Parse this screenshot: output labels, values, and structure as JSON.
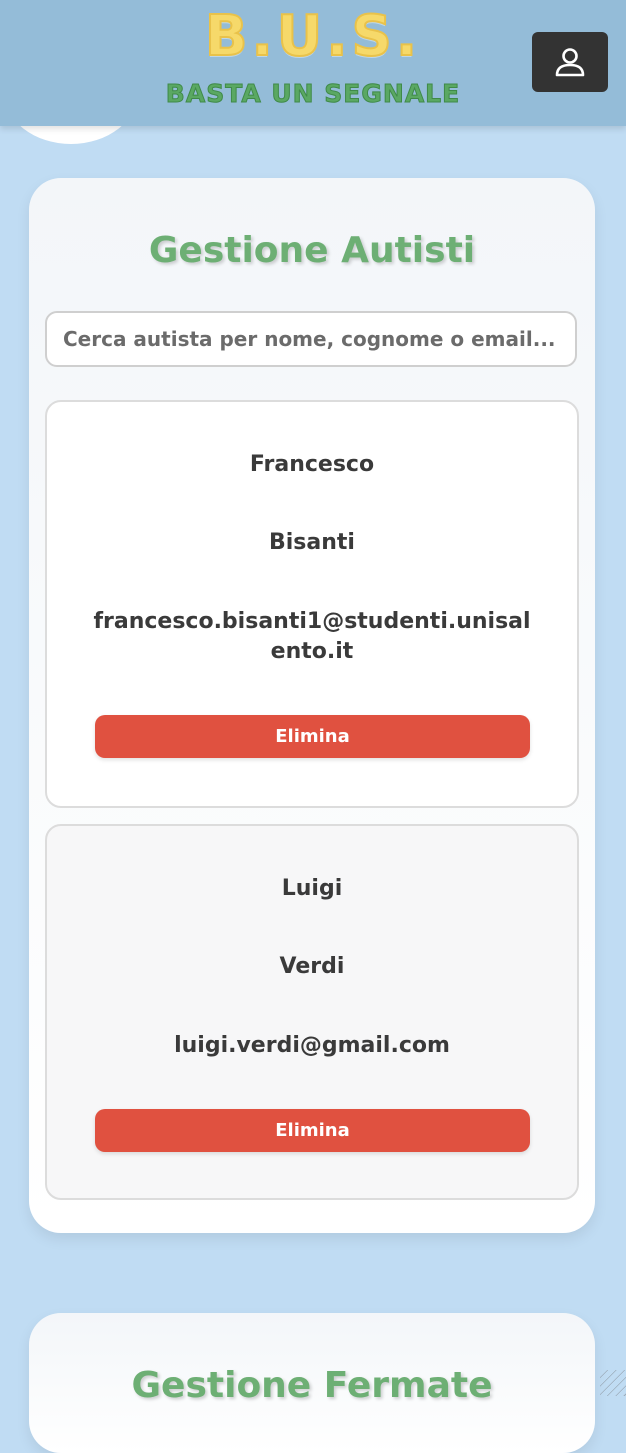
{
  "header": {
    "logo_title": "B.U.S.",
    "logo_subtitle": "BASTA UN SEGNALE",
    "user_icon": "user-icon"
  },
  "drivers_section": {
    "title": "Gestione Autisti",
    "search": {
      "placeholder": "Cerca autista per nome, cognome o email...",
      "value": ""
    },
    "drivers": [
      {
        "first_name": "Francesco",
        "last_name": "Bisanti",
        "email": "francesco.bisanti1@studenti.unisalento.it",
        "delete_label": "Elimina"
      },
      {
        "first_name": "Luigi",
        "last_name": "Verdi",
        "email": "luigi.verdi@gmail.com",
        "delete_label": "Elimina"
      }
    ]
  },
  "stops_section": {
    "title": "Gestione Fermate"
  },
  "colors": {
    "page_background": "#c0dcf3",
    "header_background": "#94bcd8",
    "title_green": "#6daf74",
    "delete_red": "#e05140",
    "logo_yellow": "#f6d96a",
    "logo_green": "#5aa863"
  }
}
